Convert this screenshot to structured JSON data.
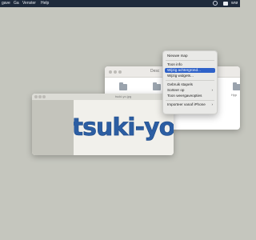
{
  "menubar": {
    "items": [
      "gave",
      "Ga",
      "Venster",
      "Help"
    ],
    "user_label": "wrø",
    "icons": [
      "clock-icon",
      "battery-icon",
      "control-center-icon"
    ]
  },
  "finder_window": {
    "title": "Desc",
    "folders": [
      {
        "label": ""
      },
      {
        "label": ""
      },
      {
        "label": "Hyp"
      }
    ]
  },
  "image_window": {
    "title": "tsuki-yo.jpg",
    "photo_text": "tsuki-yo",
    "ink_color": "#2c5ea3"
  },
  "context_menu": {
    "items": [
      {
        "label": "Nieuwe map"
      },
      {
        "label": "Toon info"
      },
      {
        "label": "Wijzig achtergrond..."
      },
      {
        "label": "Wijzig widgets..."
      },
      {
        "label": "Gebruik stapels"
      },
      {
        "label": "Sorteer op",
        "submenu": true
      },
      {
        "label": "Toon weergaveopties"
      },
      {
        "label": "Importeer vanaf iPhone",
        "submenu": true
      }
    ],
    "submenu_glyph": "›",
    "highlight_color": "#2f62c9"
  },
  "colors": {
    "desktop": "#c5c6be",
    "menubar": "#1e2a3b"
  }
}
